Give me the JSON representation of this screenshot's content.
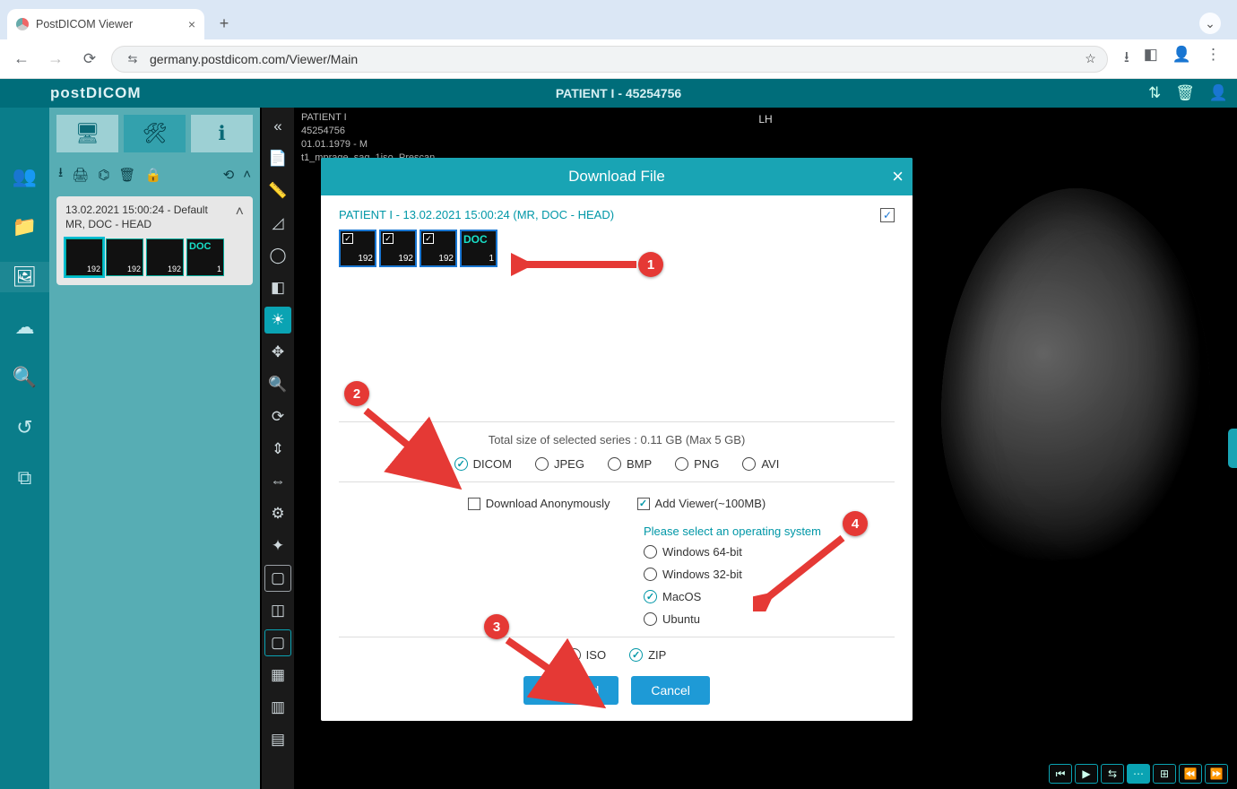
{
  "browser": {
    "tab_title": "PostDICOM Viewer",
    "url": "germany.postdicom.com/Viewer/Main"
  },
  "app": {
    "brand": "postDICOM",
    "patient_header": "PATIENT I - 45254756"
  },
  "overlay": {
    "line1": "PATIENT I",
    "line2": "45254756",
    "line3": "01.01.1979 - M",
    "line4": "t1_mprage_sag_1iso_Prescan",
    "laterality": "LH"
  },
  "series_card": {
    "line1": "13.02.2021 15:00:24 - Default",
    "line2": "MR, DOC - HEAD",
    "thumb_counts": [
      "192",
      "192",
      "192",
      "1"
    ],
    "doc_label": "DOC"
  },
  "modal": {
    "title": "Download File",
    "study_label": "PATIENT I - 13.02.2021 15:00:24 (MR, DOC - HEAD)",
    "thumb_counts": [
      "192",
      "192",
      "192",
      "1"
    ],
    "doc_label": "DOC",
    "size_line": "Total size of selected series : 0.11 GB (Max 5 GB)",
    "formats": {
      "dicom": "DICOM",
      "jpeg": "JPEG",
      "bmp": "BMP",
      "png": "PNG",
      "avi": "AVI"
    },
    "anon_label": "Download Anonymously",
    "addviewer_label": "Add Viewer(~100MB)",
    "os_title": "Please select an operating system",
    "os": {
      "win64": "Windows 64-bit",
      "win32": "Windows 32-bit",
      "mac": "MacOS",
      "ubuntu": "Ubuntu"
    },
    "archive": {
      "iso": "ISO",
      "zip": "ZIP"
    },
    "download_btn": "Download",
    "cancel_btn": "Cancel"
  },
  "callouts": {
    "b1": "1",
    "b2": "2",
    "b3": "3",
    "b4": "4"
  }
}
